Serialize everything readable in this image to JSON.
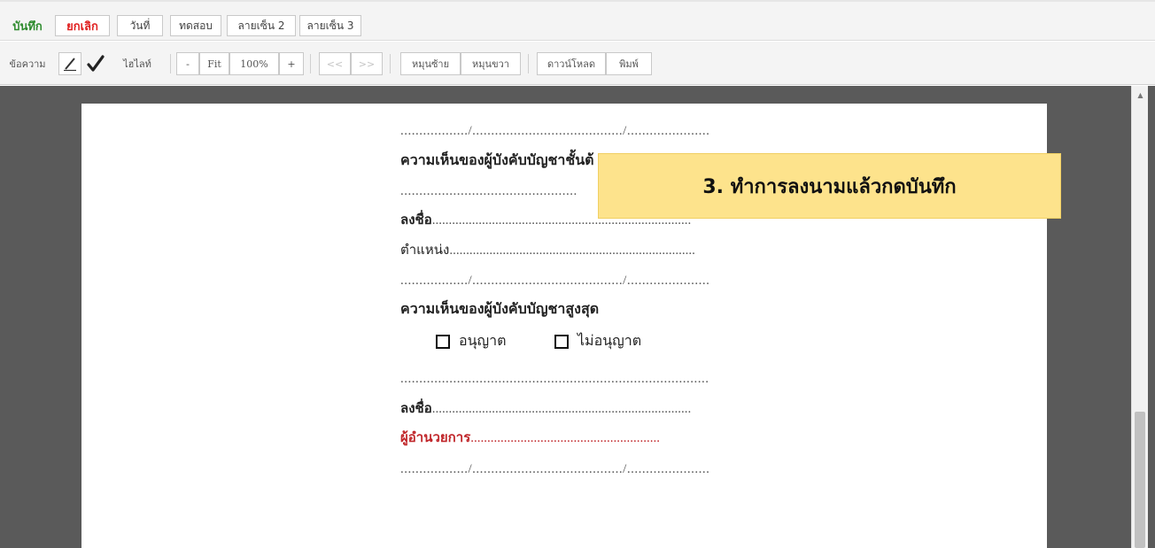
{
  "toolbar_top": {
    "save_label": "บันทึก",
    "cancel_label": "ยกเลิก",
    "date_label": "วันที่",
    "test_label": "ทดสอบ",
    "signature2_label": "ลายเซ็น 2",
    "signature3_label": "ลายเซ็น 3"
  },
  "toolbar_tools": {
    "text_label": "ข้อความ",
    "pen_icon": "pen-icon",
    "check_icon": "checkmark-icon",
    "highlight_label": "ไฮไลท์",
    "zoom_out_label": "-",
    "fit_label": "Fit",
    "zoom_value": "100%",
    "zoom_in_label": "+",
    "prev_label": "<<",
    "next_label": ">>",
    "rotate_left_label": "หมุนซ้าย",
    "rotate_right_label": "หมุนขวา",
    "download_label": "ดาวน์โหลด",
    "print_label": "พิมพ์"
  },
  "document": {
    "date_line_1": "................../......................................../......................",
    "heading_supervisor": "ความเห็นของผู้บังคับบัญชาชั้นต้",
    "opinion_line_1": "...............................................",
    "sign_label_1": "ลงชื่อ",
    "sign_dots_1": "..............................................................................",
    "position_label": "ตำแหน่ง",
    "position_dots": "..........................................................................",
    "date_line_2": "................../......................................../......................",
    "heading_top": "ความเห็นของผู้บังคับบัญชาสูงสุด",
    "approve_label": "อนุญาต",
    "disapprove_label": "ไม่อนุญาต",
    "opinion_line_2": "..................................................................................",
    "sign_label_2": "ลงชื่อ",
    "sign_dots_2": "..............................................................................",
    "director_label": "ผู้อำนวยการ",
    "director_dots": ".........................................................",
    "date_line_3": "................../......................................../......................"
  },
  "callout": {
    "text": "3. ทำการลงนามแล้วกดบันทึก",
    "color": "#fde38c"
  },
  "colors": {
    "save": "#2e8b2e",
    "cancel": "#e02020",
    "viewer_bg": "#5a5a5a",
    "director_red": "#c0262a"
  }
}
